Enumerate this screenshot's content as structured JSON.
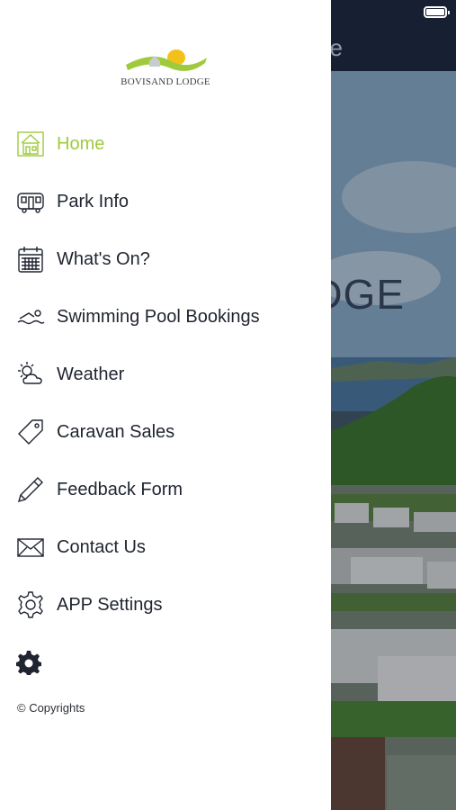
{
  "background": {
    "title_fragment": "e",
    "logo_fragment": "DGE"
  },
  "brand": {
    "name": "BOVISAND LODGE"
  },
  "menu": {
    "items": [
      {
        "label": "Home",
        "icon": "home-icon",
        "active": true
      },
      {
        "label": "Park Info",
        "icon": "caravan-icon",
        "active": false
      },
      {
        "label": "What's On?",
        "icon": "calendar-icon",
        "active": false
      },
      {
        "label": "Swimming Pool Bookings",
        "icon": "swimmer-icon",
        "active": false
      },
      {
        "label": "Weather",
        "icon": "weather-icon",
        "active": false
      },
      {
        "label": "Caravan Sales",
        "icon": "tag-icon",
        "active": false
      },
      {
        "label": "Feedback Form",
        "icon": "pencil-icon",
        "active": false
      },
      {
        "label": "Contact Us",
        "icon": "envelope-icon",
        "active": false
      },
      {
        "label": "APP Settings",
        "icon": "settings-gear-icon",
        "active": false
      }
    ]
  },
  "footer": {
    "copyright": "© Copyrights"
  },
  "colors": {
    "accent": "#9ecb3c",
    "text": "#1f2430",
    "navbar": "#172033"
  }
}
